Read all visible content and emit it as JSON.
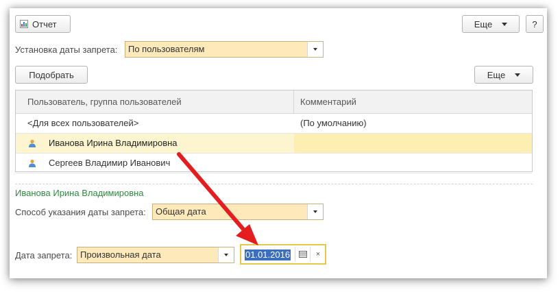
{
  "toolbar": {
    "report_label": "Отчет",
    "more_label": "Еще",
    "help_label": "?"
  },
  "ban_setting": {
    "label": "Установка даты запрета:",
    "value": "По пользователям"
  },
  "list_toolbar": {
    "pick_label": "Подобрать",
    "more_label": "Еще"
  },
  "table": {
    "columns": [
      "Пользователь, группа пользователей",
      "Комментарий"
    ],
    "rows": [
      {
        "user": "<Для всех пользователей>",
        "comment": "(По умолчанию)"
      },
      {
        "user": "Иванова Ирина Владимировна",
        "comment": ""
      },
      {
        "user": "Сергеев Владимир Иванович",
        "comment": ""
      }
    ]
  },
  "details": {
    "group_title": "Иванова Ирина Владимировна",
    "method_label": "Способ указания даты запрета:",
    "method_value": "Общая дата",
    "date_label": "Дата запрета:",
    "date_kind_value": "Произвольная дата",
    "date_value": "01.01.2016",
    "clear_symbol": "×"
  },
  "colors": {
    "accent_green": "#2b8a3e",
    "field_fill": "#fde9b9",
    "selected_row": "#fcf5cf",
    "date_focus_border": "#e5c84a",
    "selection_blue": "#3c6ebf",
    "arrow_red": "#e41e1e"
  },
  "icons": {
    "report": "report-icon",
    "user": "user-icon",
    "calendar": "calendar-icon",
    "clear": "clear-icon"
  }
}
